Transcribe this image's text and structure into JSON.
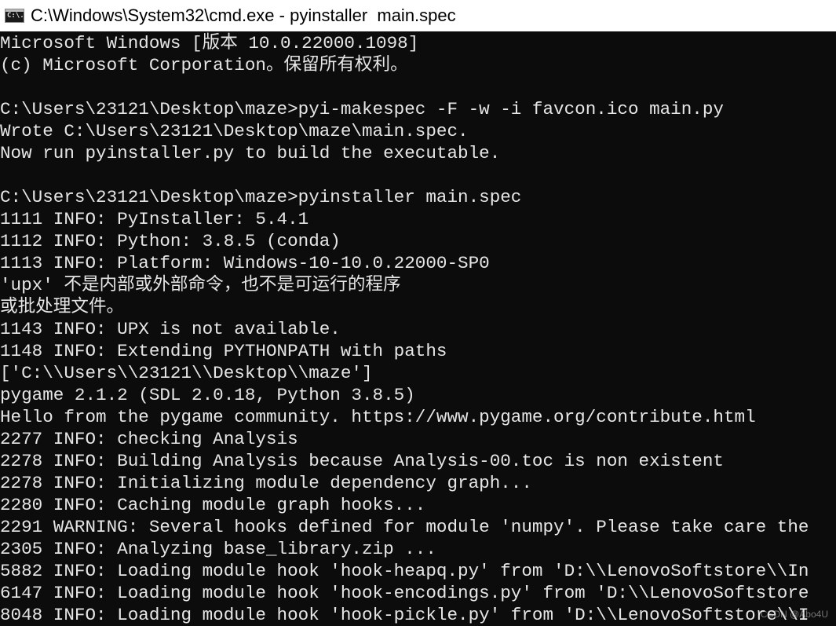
{
  "window": {
    "title": "C:\\Windows\\System32\\cmd.exe - pyinstaller  main.spec",
    "icon": "cmd-icon",
    "icon_text": "C:\\."
  },
  "console": {
    "lines": [
      "Microsoft Windows [版本 10.0.22000.1098]",
      "(c) Microsoft Corporation。保留所有权利。",
      "",
      "C:\\Users\\23121\\Desktop\\maze>pyi-makespec -F -w -i favcon.ico main.py",
      "Wrote C:\\Users\\23121\\Desktop\\maze\\main.spec.",
      "Now run pyinstaller.py to build the executable.",
      "",
      "C:\\Users\\23121\\Desktop\\maze>pyinstaller main.spec",
      "1111 INFO: PyInstaller: 5.4.1",
      "1112 INFO: Python: 3.8.5 (conda)",
      "1113 INFO: Platform: Windows-10-10.0.22000-SP0",
      "'upx' 不是内部或外部命令，也不是可运行的程序",
      "或批处理文件。",
      "1143 INFO: UPX is not available.",
      "1148 INFO: Extending PYTHONPATH with paths",
      "['C:\\\\Users\\\\23121\\\\Desktop\\\\maze']",
      "pygame 2.1.2 (SDL 2.0.18, Python 3.8.5)",
      "Hello from the pygame community. https://www.pygame.org/contribute.html",
      "2277 INFO: checking Analysis",
      "2278 INFO: Building Analysis because Analysis-00.toc is non existent",
      "2278 INFO: Initializing module dependency graph...",
      "2280 INFO: Caching module graph hooks...",
      "2291 WARNING: Several hooks defined for module 'numpy'. Please take care the",
      "2305 INFO: Analyzing base_library.zip ...",
      "5882 INFO: Loading module hook 'hook-heapq.py' from 'D:\\\\LenovoSoftstore\\\\In",
      "6147 INFO: Loading module hook 'hook-encodings.py' from 'D:\\\\LenovoSoftstore",
      "8048 INFO: Loading module hook 'hook-pickle.py' from 'D:\\\\LenovoSoftstore\\\\I"
    ]
  },
  "watermark": "CSDN @Abo4U",
  "colors": {
    "background": "#0c0c0c",
    "text": "#e6e6e6",
    "titlebar": "#ffffff"
  }
}
